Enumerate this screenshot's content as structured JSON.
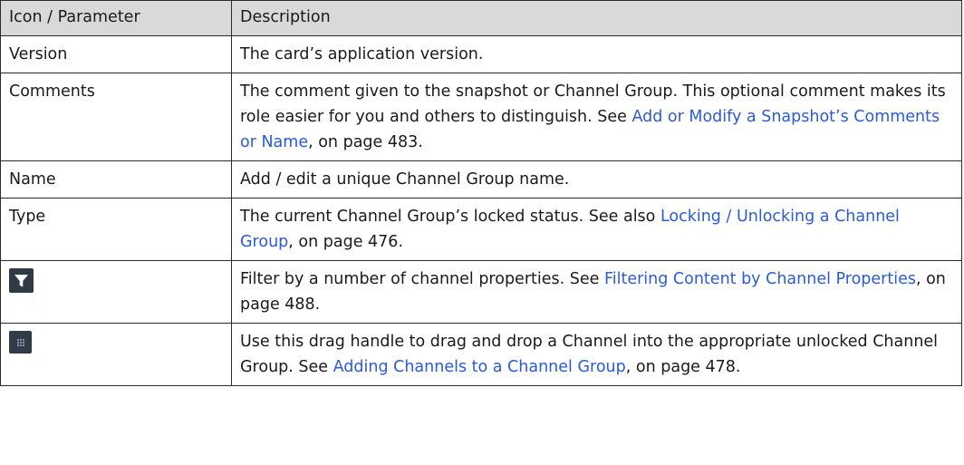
{
  "table": {
    "headers": [
      "Icon / Parameter",
      "Description"
    ],
    "rows": [
      {
        "param": "Version",
        "desc_before": "The card’s application version.",
        "link": "",
        "desc_after": ""
      },
      {
        "param": "Comments",
        "desc_before": "The comment given to the snapshot or Channel Group. This optional comment makes its role easier for you and others to distinguish. See ",
        "link": "Add or Modify a Snapshot’s Comments or Name",
        "desc_after": ", on page 483."
      },
      {
        "param": "Name",
        "desc_before": "Add / edit a unique Channel Group name.",
        "link": "",
        "desc_after": ""
      },
      {
        "param": "Type",
        "desc_before": "The current Channel Group’s locked status. See also ",
        "link": "Locking / Unlocking a Channel Group",
        "desc_after": ", on page 476."
      },
      {
        "icon": "filter-icon",
        "desc_before": "Filter by a number of channel properties. See ",
        "link": "Filtering Content by Channel Properties",
        "desc_after": ", on page 488."
      },
      {
        "icon": "drag-handle-icon",
        "desc_before": "Use this drag handle to drag and drop a Channel into the appropriate unlocked Channel Group. See ",
        "link": "Adding Channels to a Channel Group",
        "desc_after": ", on page 478."
      }
    ]
  },
  "colors": {
    "header_bg": "#d9d9d9",
    "link": "#2a5bd7",
    "icon_bg": "#2e3a46"
  }
}
